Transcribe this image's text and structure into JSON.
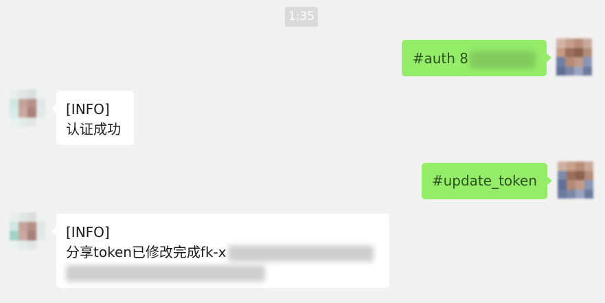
{
  "chat": {
    "time": "1:35",
    "messages": [
      {
        "side": "outgoing",
        "lines": [
          "#auth 8"
        ],
        "redacted": true
      },
      {
        "side": "incoming",
        "lines": [
          "[INFO]",
          "认证成功"
        ],
        "redacted": false
      },
      {
        "side": "outgoing",
        "lines": [
          "#update_token"
        ],
        "redacted": false
      },
      {
        "side": "incoming",
        "lines": [
          "[INFO]",
          "分享token已修改完成fk-x"
        ],
        "redacted": true
      }
    ]
  },
  "colors": {
    "background": "#f1f1f1",
    "outgoing_bubble": "#95ec69",
    "incoming_bubble": "#ffffff",
    "time_badge": "#dadada"
  }
}
